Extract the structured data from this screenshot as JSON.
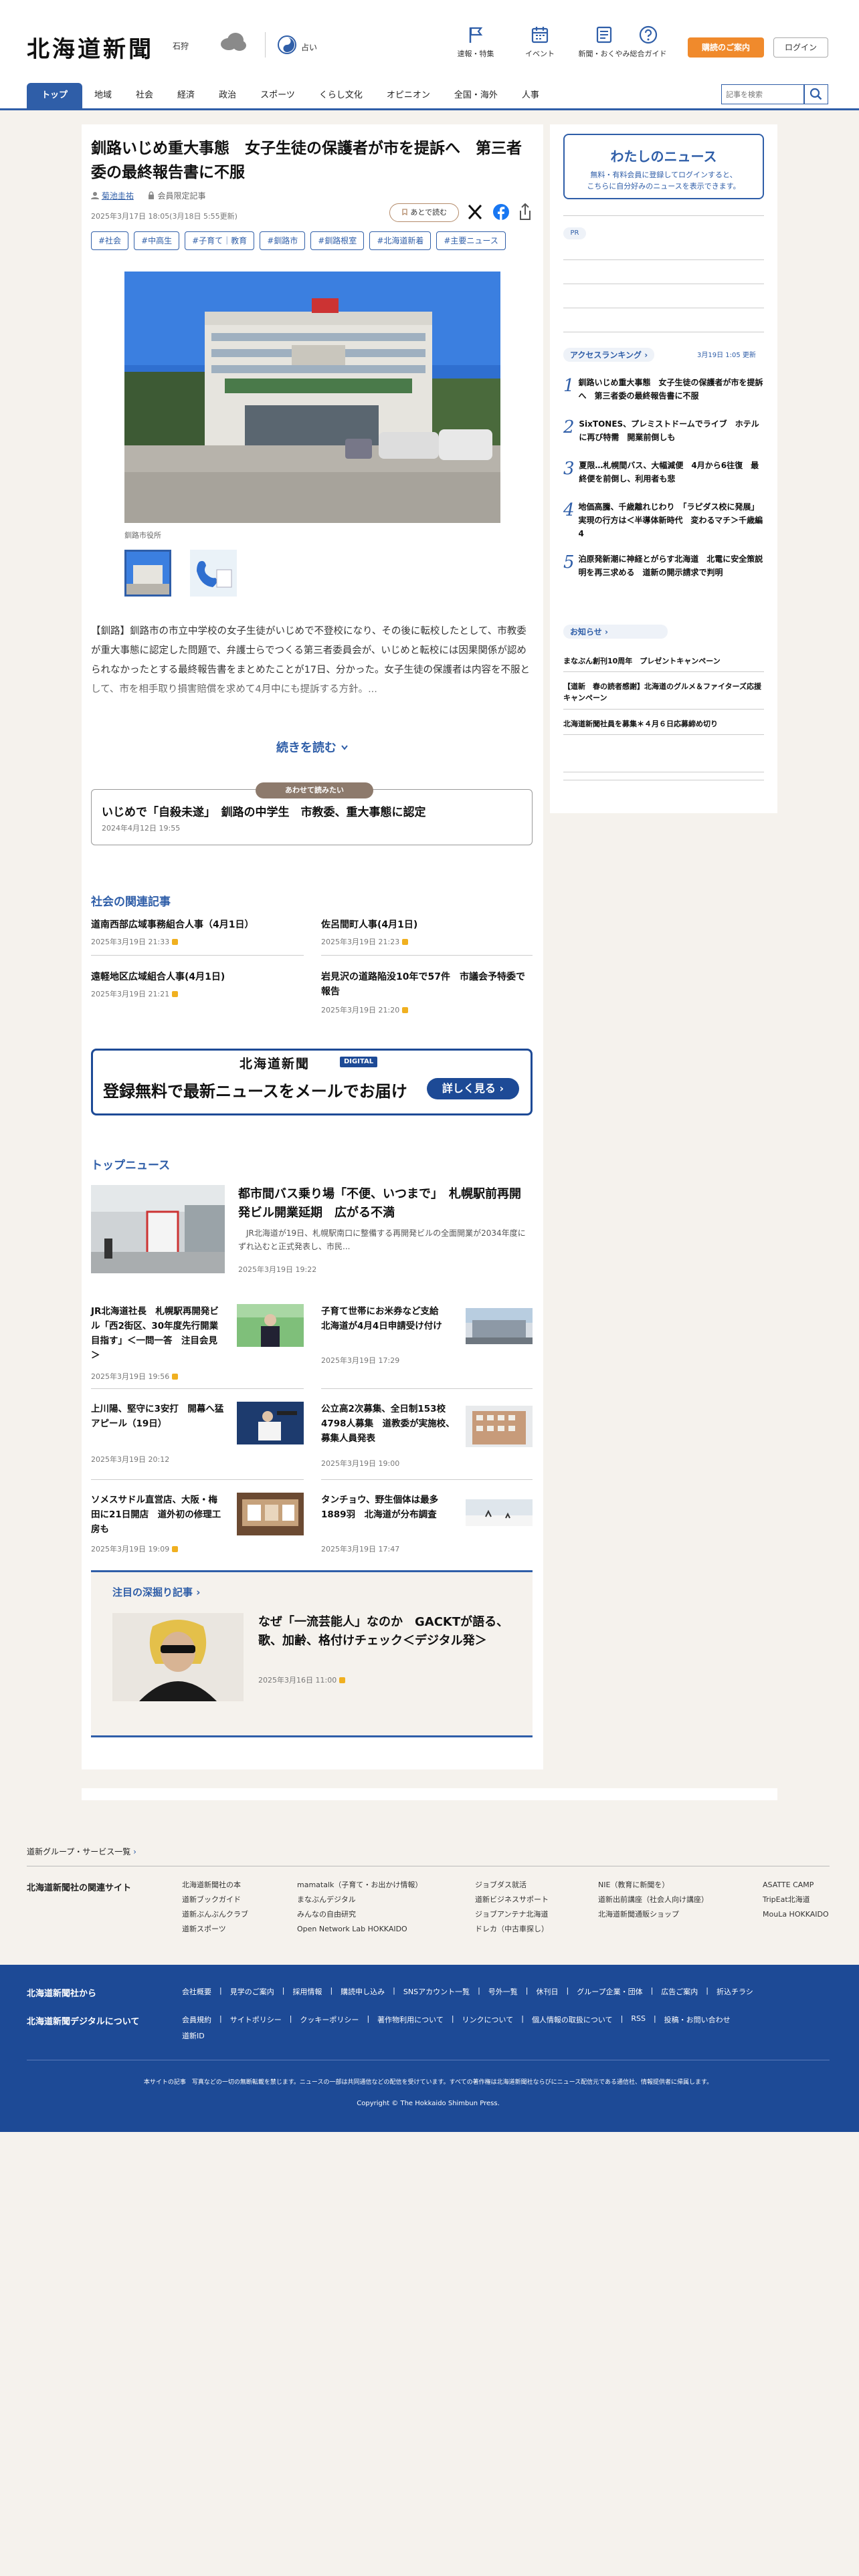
{
  "header": {
    "logo": "北海道新聞",
    "weather_city": "石狩",
    "fortune": "占い",
    "nav_icons": [
      {
        "label": "速報・特集",
        "icon": "flag-icon"
      },
      {
        "label": "イベント",
        "icon": "calendar-icon"
      },
      {
        "label": "新聞・おくやみ",
        "icon": "newspaper-icon"
      },
      {
        "label": "総合ガイド",
        "icon": "help-icon"
      }
    ],
    "subscribe": "購読のご案内",
    "login": "ログイン"
  },
  "nav": [
    "トップ",
    "地域",
    "社会",
    "経済",
    "政治",
    "スポーツ",
    "くらし文化",
    "オピニオン",
    "全国・海外",
    "人事"
  ],
  "search": {
    "placeholder": "記事を検索"
  },
  "article": {
    "title": "釧路いじめ重大事態　女子生徒の保護者が市を提訴へ　第三者委の最終報告書に不服",
    "author": "菊池圭祐",
    "member": "会員限定記事",
    "date": "2025年3月17日 18:05(3月18日 5:55更新)",
    "read_later": "あとで読む",
    "tags": [
      "#社会",
      "#中高生",
      "#子育て｜教育",
      "#釧路市",
      "#釧路根室",
      "#北海道新着",
      "#主要ニュース"
    ],
    "caption": "釧路市役所",
    "lead": "【釧路】釧路市の市立中学校の女子生徒がいじめで不登校になり、その後に転校したとして、市教委が重大事態に認定した問題で、弁護士らでつくる第三者委員会が、いじめと転校には因果関係が認められなかったとする最終報告書をまとめたことが17日、分かった。女子生徒の保護者は内容を不服として、市を相手取り損害賠償を求めて4月中にも提訴する方針。...",
    "read_more": "続きを読む"
  },
  "related": {
    "badge": "あわせて読みたい",
    "title": "いじめで「自殺未遂」　釧路の中学生　市教委、重大事態に認定",
    "date": "2024年4月12日 19:55"
  },
  "society": {
    "heading": "社会の関連記事",
    "items": [
      {
        "title": "道南西部広域事務組合人事（4月1日）",
        "date": "2025年3月19日 21:33"
      },
      {
        "title": "佐呂間町人事(4月1日)",
        "date": "2025年3月19日 21:23"
      },
      {
        "title": "遠軽地区広域組合人事(4月1日)",
        "date": "2025年3月19日 21:21"
      },
      {
        "title": "岩見沢の道路陥没10年で57件　市議会予特委で報告",
        "date": "2025年3月19日 21:20"
      }
    ]
  },
  "banner": {
    "logo": "北海道新聞",
    "digital": "DIGITAL",
    "main": "登録無料で最新ニュースをメールでお届け",
    "button": "詳しく見る"
  },
  "top_news": {
    "heading": "トップニュース",
    "lead": {
      "title": "都市間バス乗り場「不便、いつまで」　札幌駅前再開発ビル開業延期　広がる不満",
      "summary": "　JR北海道が19日、札幌駅南口に整備する再開発ビルの全面開業が2034年度にずれ込むと正式発表し、市民...",
      "date": "2025年3月19日 19:22"
    },
    "items": [
      {
        "title": "JR北海道社長　札幌駅再開発ビル「西2街区、30年度先行開業目指す」＜一問一答　注目会見＞",
        "date": "2025年3月19日 19:56"
      },
      {
        "title": "子育て世帯にお米券など支給　北海道が4月4日申請受け付け",
        "date": "2025年3月19日 17:29"
      },
      {
        "title": "上川陽、堅守に3安打　開幕へ猛アピール（19日）",
        "date": "2025年3月19日 20:12"
      },
      {
        "title": "公立高2次募集、全日制153校4798人募集　道教委が実施校、募集人員発表",
        "date": "2025年3月19日 19:00"
      },
      {
        "title": "ソメスサドル直営店、大阪・梅田に21日開店　道外初の修理工房も",
        "date": "2025年3月19日 19:09"
      },
      {
        "title": "タンチョウ、野生個体は最多1889羽　北海道が分布調査",
        "date": "2025年3月19日 17:47"
      }
    ]
  },
  "feature": {
    "heading": "注目の深掘り記事",
    "title": "なぜ「一流芸能人」なのか　GACKTが語る、歌、加齢、格付けチェック＜デジタル発＞",
    "date": "2025年3月16日 11:00"
  },
  "sidebar": {
    "my_news_title": "わたしのニュース",
    "my_news_text1": "無料・有料会員に登録してログインすると、",
    "my_news_text2": "こちらに自分好みのニュースを表示できます。",
    "pr": "PR",
    "ranking_heading": "アクセスランキング",
    "ranking_updated": "3月19日 1:05 更新",
    "ranking": [
      "釧路いじめ重大事態　女子生徒の保護者が市を提訴へ　第三者委の最終報告書に不服",
      "SixTONES、プレミストドームでライブ　ホテルに再び特需　開業前倒しも",
      "夏限…札幌間バス、大幅減便　4月から6往復　最終便を前倒し、利用者も悲",
      "地価高騰、千歳離れじわり　「ラピダス校に発展」実現の行方は＜半導体新時代　変わるマチ＞千歳編4",
      "泊原発新潮に神経とがらす北海道　北電に安全策説明を再三求める　道新の開示請求で判明"
    ],
    "notice_heading": "お知らせ",
    "notices": [
      "まなぶん創刊10周年　プレゼントキャンペーン",
      "【道新　春の読者感謝】北海道のグルメ＆ファイターズ応援キャンペーン",
      "北海道新聞社員を募集＊４月６日応募締め切り"
    ]
  },
  "footer": {
    "group_link": "道新グループ・サービス一覧",
    "related_heading": "北海道新聞社の関連サイト",
    "col1": [
      "北海道新聞社の本",
      "道新ブックガイド",
      "道新ぶんぶんクラブ",
      "道新スポーツ"
    ],
    "col2": [
      "mamatalk（子育て・お出かけ情報）",
      "まなぶんデジタル",
      "みんなの自由研究",
      "Open Network Lab HOKKAIDO"
    ],
    "col3": [
      "ジョブダス就活",
      "道新ビジネスサポート",
      "ジョブアンテナ北海道",
      "ドレカ（中古車探し）"
    ],
    "col4": [
      "NIE（教育に新聞を）",
      "道新出前講座（社会人向け講座）",
      "北海道新聞通販ショップ"
    ],
    "col5": [
      "ASATTE CAMP",
      "TripEat北海道",
      "MouLa HOKKAIDO"
    ],
    "blue_h1": "北海道新聞社から",
    "blue_h2": "北海道新聞デジタルについて",
    "blue_row1": [
      "会社概要",
      "見学のご案内",
      "採用情報",
      "購読申し込み",
      "SNSアカウント一覧",
      "号外一覧",
      "休刊日",
      "グループ企業・団体",
      "広告ご案内",
      "折込チラシ"
    ],
    "blue_row2": [
      "会員規約",
      "サイトポリシー",
      "クッキーポリシー",
      "著作物利用について",
      "リンクについて",
      "個人情報の取扱について",
      "RSS",
      "投稿・お問い合わせ"
    ],
    "blue_row3": [
      "道新ID"
    ],
    "notice": "本サイトの記事　写真などの一切の無断転載を禁じます。ニュースの一部は共同通信などの配信を受けています。すべての著作権は北海道新聞社ならびにニュース配信元である通信社、情報提供者に帰属します。",
    "copyright": "Copyright © The Hokkaido Shimbun Press."
  }
}
